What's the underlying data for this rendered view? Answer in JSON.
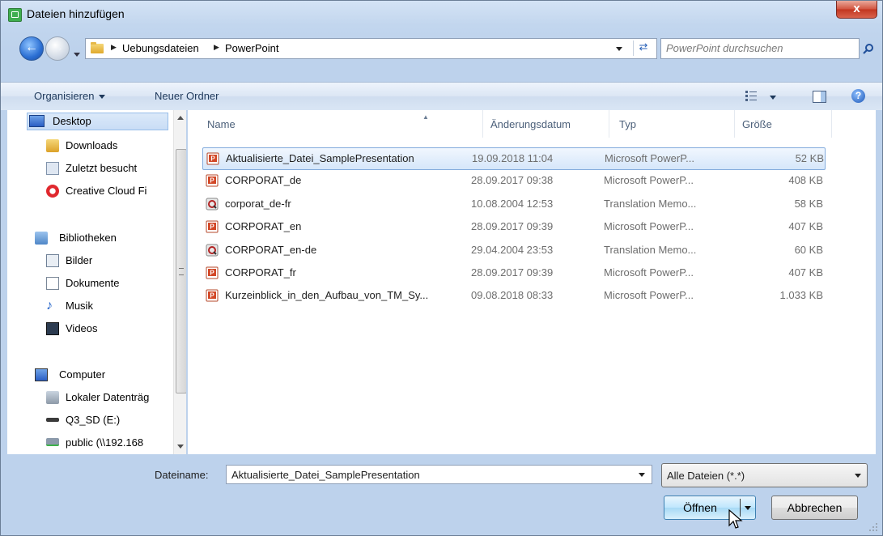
{
  "window": {
    "title": "Dateien hinzufügen",
    "close_label": "x"
  },
  "address": {
    "crumbs": [
      "Uebungsdateien",
      "PowerPoint"
    ],
    "search_placeholder": "PowerPoint durchsuchen"
  },
  "toolbar": {
    "organize_label": "Organisieren",
    "new_folder_label": "Neuer Ordner",
    "help_label": "?"
  },
  "nav": {
    "favorites": [
      "Desktop",
      "Downloads",
      "Zuletzt besucht",
      "Creative Cloud Fi"
    ],
    "libraries_label": "Bibliotheken",
    "libraries": [
      "Bilder",
      "Dokumente",
      "Musik",
      "Videos"
    ],
    "computer_label": "Computer",
    "drives": [
      "Lokaler Datenträg",
      "Q3_SD (E:)",
      "public (\\\\192.168"
    ]
  },
  "files": {
    "columns": [
      "Name",
      "Änderungsdatum",
      "Typ",
      "Größe"
    ],
    "rows": [
      {
        "name": "Aktualisierte_Datei_SamplePresentation",
        "date": "19.09.2018 11:04",
        "type": "Microsoft PowerP...",
        "size": "52 KB",
        "icon": "powerpoint-icon"
      },
      {
        "name": "CORPORAT_de",
        "date": "28.09.2017 09:38",
        "type": "Microsoft PowerP...",
        "size": "408 KB",
        "icon": "powerpoint-icon"
      },
      {
        "name": "corporat_de-fr",
        "date": "10.08.2004 12:53",
        "type": "Translation Memo...",
        "size": "58 KB",
        "icon": "translation-memory-icon"
      },
      {
        "name": "CORPORAT_en",
        "date": "28.09.2017 09:39",
        "type": "Microsoft PowerP...",
        "size": "407 KB",
        "icon": "powerpoint-icon"
      },
      {
        "name": "CORPORAT_en-de",
        "date": "29.04.2004 23:53",
        "type": "Translation Memo...",
        "size": "60 KB",
        "icon": "translation-memory-icon"
      },
      {
        "name": "CORPORAT_fr",
        "date": "28.09.2017 09:39",
        "type": "Microsoft PowerP...",
        "size": "407 KB",
        "icon": "powerpoint-icon"
      },
      {
        "name": "Kurzeinblick_in_den_Aufbau_von_TM_Sy...",
        "date": "09.08.2018 08:33",
        "type": "Microsoft PowerP...",
        "size": "1.033 KB",
        "icon": "powerpoint-icon"
      }
    ]
  },
  "bottom": {
    "filename_label": "Dateiname:",
    "filename_value": "Aktualisierte_Datei_SamplePresentation",
    "filter_value": "Alle Dateien (*.*)",
    "open_label": "Öffnen",
    "cancel_label": "Abbrechen"
  }
}
